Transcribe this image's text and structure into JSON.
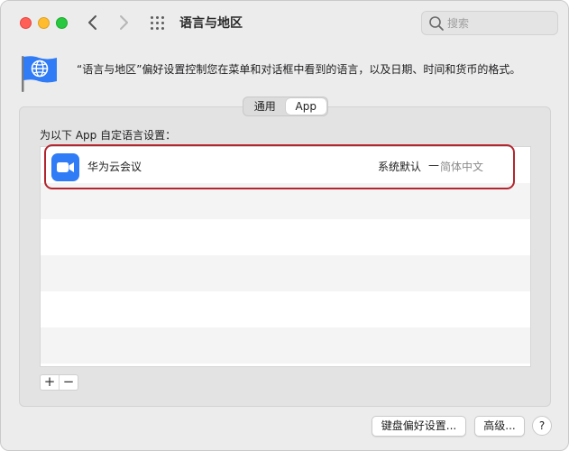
{
  "window": {
    "title": "语言与地区",
    "search": {
      "placeholder": "搜索",
      "value": ""
    }
  },
  "header": {
    "description": "“语言与地区”偏好设置控制您在菜单和对话框中看到的语言，以及日期、时间和货币的格式。"
  },
  "tabs": [
    {
      "label": "通用",
      "selected": false
    },
    {
      "label": "App",
      "selected": true
    }
  ],
  "apps_section": {
    "title": "为以下 App 自定语言设置：",
    "apps": [
      {
        "name": "华为云会议",
        "icon": "video-camera-icon",
        "language_prefix": "系统默认",
        "language_dash": "—",
        "language": "简体中文"
      }
    ],
    "add_label": "+",
    "remove_label": "−"
  },
  "footer": {
    "keyboard_prefs_label": "键盘偏好设置...",
    "advanced_label": "高级...",
    "help_label": "?"
  },
  "colors": {
    "accent_blue": "#2f7cf6",
    "highlight_ring": "#b3262f",
    "close": "#ff5f57",
    "minimize": "#febc2e",
    "maximize": "#28c840"
  }
}
